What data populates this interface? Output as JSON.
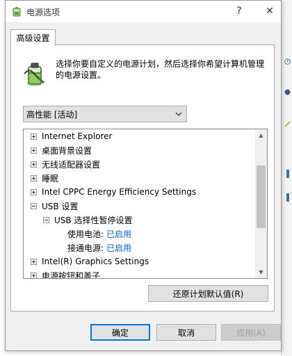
{
  "window": {
    "title": "电源选项",
    "help_glyph": "?",
    "close_glyph": "✕"
  },
  "tab": {
    "label": "高级设置"
  },
  "description": "选择你要自定义的电源计划，然后选择你希望计算机管理的电源设置。",
  "plan_select": {
    "value": "高性能 [活动]"
  },
  "tree": {
    "items": [
      {
        "label": "Internet Explorer",
        "expander": "plus"
      },
      {
        "label": "桌面背景设置",
        "expander": "plus"
      },
      {
        "label": "无线适配器设置",
        "expander": "plus"
      },
      {
        "label": "睡眠",
        "expander": "plus"
      },
      {
        "label": "Intel CPPC Energy Efficiency Settings",
        "expander": "plus"
      },
      {
        "label": "USB 设置",
        "expander": "minus"
      },
      {
        "label": "USB 选择性暂停设置",
        "expander": "minus"
      },
      {
        "label": "使用电池:",
        "value": "已启用"
      },
      {
        "label": "接通电源:",
        "value": "已启用"
      },
      {
        "label": "Intel(R) Graphics Settings",
        "expander": "plus"
      },
      {
        "label": "电源按钮和盖子",
        "expander": "plus"
      }
    ],
    "scroll_up": "▲",
    "scroll_down": "▼"
  },
  "buttons": {
    "restore_defaults": "还原计划默认值(R)",
    "ok": "确定",
    "cancel": "取消",
    "apply": "应用(A)"
  },
  "colors": {
    "link_value": "#0066cc",
    "focus_border": "#0078d7"
  }
}
